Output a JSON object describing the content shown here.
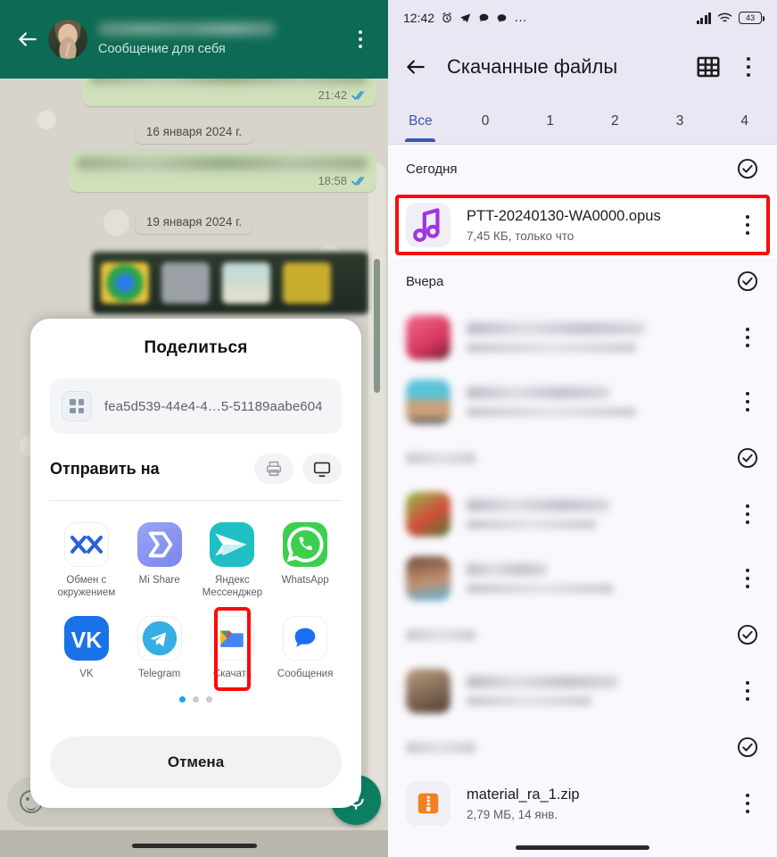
{
  "whatsapp": {
    "subtitle": "Сообщение для себя",
    "back_icon": "arrow-left-icon",
    "menu_icon": "kebab-menu-icon",
    "messages": [
      {
        "time": "21:42",
        "status": "read"
      },
      {
        "time": "18:58",
        "status": "read"
      }
    ],
    "date_chips": [
      "16 января 2024 г.",
      "19 января 2024 г."
    ],
    "fab_icon": "microphone-icon",
    "emoji_icon": "emoji-smile-icon"
  },
  "share_sheet": {
    "title": "Поделиться",
    "file": {
      "name": "fea5d539-44e4-4…5-51189aabe604",
      "icon": "apps-grid-icon"
    },
    "send_to_label": "Отправить на",
    "quick_actions": [
      {
        "name": "print-icon",
        "label": "Печать"
      },
      {
        "name": "cast-icon",
        "label": "Трансляция"
      }
    ],
    "apps_row1": [
      {
        "label": "Обмен с окружением",
        "icon": "nearby-share-icon",
        "highlighted": false
      },
      {
        "label": "Mi Share",
        "icon": "mi-share-icon",
        "highlighted": false
      },
      {
        "label": "Яндекс Мессенджер",
        "icon": "yandex-messenger-icon",
        "highlighted": false
      },
      {
        "label": "WhatsApp",
        "icon": "whatsapp-icon",
        "highlighted": false
      }
    ],
    "apps_row2": [
      {
        "label": "VK",
        "icon": "vk-icon",
        "highlighted": false
      },
      {
        "label": "Telegram",
        "icon": "telegram-icon",
        "highlighted": false
      },
      {
        "label": "Скачать",
        "icon": "google-files-icon",
        "highlighted": true
      },
      {
        "label": "Сообщения",
        "icon": "google-messages-icon",
        "highlighted": false
      }
    ],
    "page_dots": {
      "count": 3,
      "active_index": 0
    },
    "cancel_label": "Отмена"
  },
  "files_app": {
    "status_bar": {
      "time": "12:42",
      "left_icons": [
        "alarm-clock-icon",
        "telegram-icon",
        "message-icon",
        "chat-bubble-icon",
        "more-dots-icon"
      ],
      "right_icons": [
        "signal-icon",
        "wifi-icon"
      ],
      "battery": "43"
    },
    "header": {
      "title": "Скачанные файлы",
      "back_icon": "arrow-left-icon",
      "grid_icon": "grid-view-icon",
      "menu_icon": "kebab-menu-icon"
    },
    "tabs": [
      {
        "label": "Все",
        "active": true
      },
      {
        "label": "0",
        "active": false
      },
      {
        "label": "1",
        "active": false
      },
      {
        "label": "2",
        "active": false
      },
      {
        "label": "3",
        "active": false
      },
      {
        "label": "4",
        "active": false
      }
    ],
    "groups": [
      {
        "title": "Сегодня",
        "blurred_title": false,
        "check_icon": "check-circle-icon",
        "rows": [
          {
            "name": "PTT-20240130-WA0000.opus",
            "sub": "7,45 КБ, только что",
            "icon": "music-note-icon",
            "icon_kind": "audio",
            "blurred": false,
            "highlighted": true
          }
        ]
      },
      {
        "title": "Вчера",
        "blurred_title": false,
        "check_icon": "check-circle-icon",
        "rows": [
          {
            "name": "",
            "sub": "",
            "icon_kind": "thumb",
            "thumb_color": "#e8486f",
            "blurred": true,
            "highlighted": false,
            "name_w": 200,
            "sub_w": 190
          },
          {
            "name": "",
            "sub": "",
            "icon_kind": "thumb",
            "thumb_color": "#58b8cf",
            "blurred": true,
            "highlighted": false,
            "name_w": 160,
            "sub_w": 190
          }
        ]
      },
      {
        "title": "",
        "blurred_title": true,
        "check_icon": "check-circle-icon",
        "rows": [
          {
            "name": "",
            "sub": "",
            "icon_kind": "thumb",
            "thumb_color": "#79a843",
            "blurred": true,
            "highlighted": false,
            "name_w": 160,
            "sub_w": 145
          },
          {
            "name": "",
            "sub": "",
            "icon_kind": "thumb",
            "thumb_color": "#9a6b52",
            "blurred": true,
            "highlighted": false,
            "name_w": 90,
            "sub_w": 165
          }
        ]
      },
      {
        "title": "",
        "blurred_title": true,
        "check_icon": "check-circle-icon",
        "rows": [
          {
            "name": "",
            "sub": "",
            "icon_kind": "thumb",
            "thumb_color": "#8a7a6a",
            "blurred": true,
            "highlighted": false,
            "name_w": 170,
            "sub_w": 140
          }
        ]
      },
      {
        "title": "",
        "blurred_title": true,
        "check_icon": "check-circle-icon",
        "rows": [
          {
            "name": "material_ra_1.zip",
            "sub": "2,79 МБ, 14 янв.",
            "icon": "zip-archive-icon",
            "icon_kind": "zip",
            "blurred": false,
            "highlighted": false
          }
        ]
      }
    ]
  },
  "colors": {
    "whatsapp_green": "#0d6a54",
    "bubble_green": "#cfe0bb",
    "highlight_red": "#fb0b0b",
    "files_accent": "#3d56a8",
    "audio_purple": "#a233e0",
    "zip_orange": "#f4801f"
  }
}
